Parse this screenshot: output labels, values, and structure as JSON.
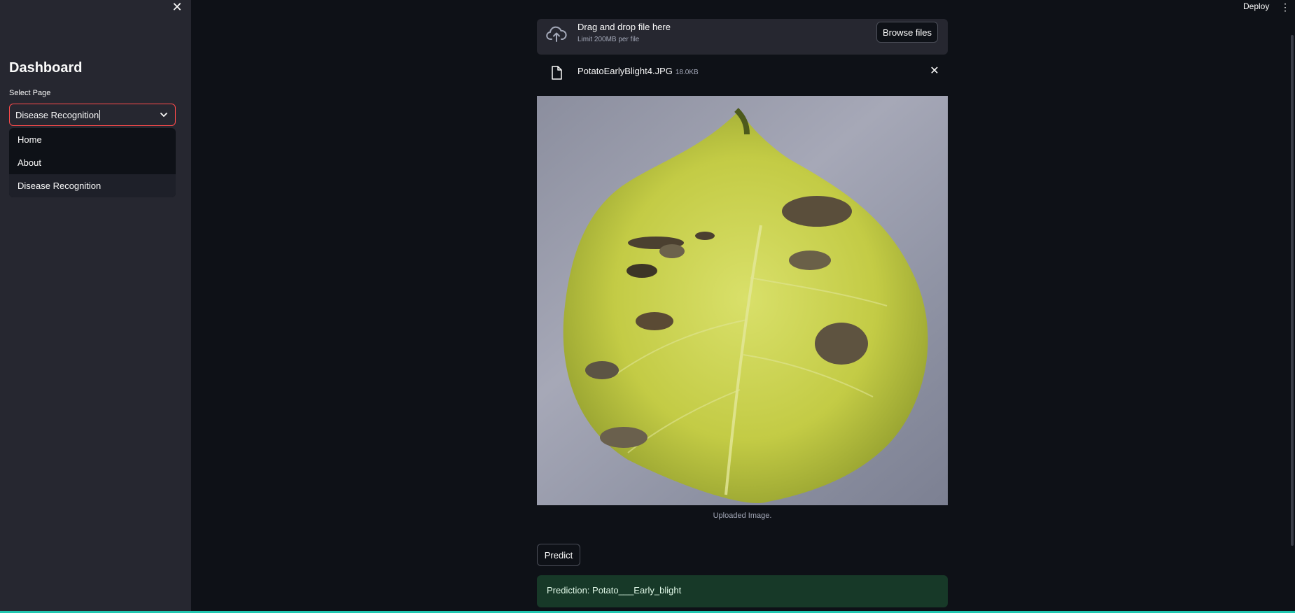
{
  "header": {
    "deploy_label": "Deploy",
    "menu_icon": "more-vertical-icon"
  },
  "sidebar": {
    "close_icon": "close-icon",
    "title": "Dashboard",
    "select_label": "Select Page",
    "select_value": "Disease Recognition",
    "options": [
      {
        "label": "Home"
      },
      {
        "label": "About"
      },
      {
        "label": "Disease Recognition"
      }
    ]
  },
  "uploader": {
    "icon": "cloud-upload-icon",
    "title": "Drag and drop file here",
    "subtitle": "Limit 200MB per file",
    "browse_label": "Browse files"
  },
  "file": {
    "icon": "file-icon",
    "name": "PotatoEarlyBlight4.JPG",
    "size": "18.0KB"
  },
  "image": {
    "caption": "Uploaded Image."
  },
  "actions": {
    "predict_label": "Predict"
  },
  "result": {
    "text": "Prediction: Potato___Early_blight"
  },
  "colors": {
    "accent": "#ff4b4b",
    "success_bg": "#173928",
    "background": "#0e1117",
    "sidebar_bg": "#262730"
  }
}
